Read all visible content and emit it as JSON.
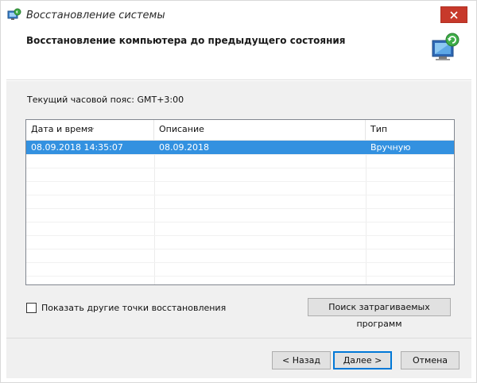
{
  "window": {
    "title": "Восстановление системы",
    "icons": {
      "app": "system-restore-icon",
      "close": "close-icon"
    }
  },
  "header": {
    "title": "Восстановление компьютера до предыдущего состояния",
    "icon": "computer-restore-icon"
  },
  "timezone_label": "Текущий часовой пояс: GMT+3:00",
  "table": {
    "columns": [
      "Дата и время",
      "Описание",
      "Тип"
    ],
    "sort_icon": "sort-down-arrow-icon",
    "rows": [
      {
        "datetime": "08.09.2018 14:35:07",
        "description": "08.09.2018",
        "type": "Вручную",
        "selected": true
      }
    ]
  },
  "show_more": {
    "label": "Показать другие точки восстановления",
    "checked": false
  },
  "buttons": {
    "scan": "Поиск затрагиваемых программ",
    "back": "< Назад",
    "next": "Далее >",
    "cancel": "Отмена"
  },
  "colors": {
    "selection": "#3391e0",
    "close": "#c7392b",
    "accent": "#0078d7"
  }
}
